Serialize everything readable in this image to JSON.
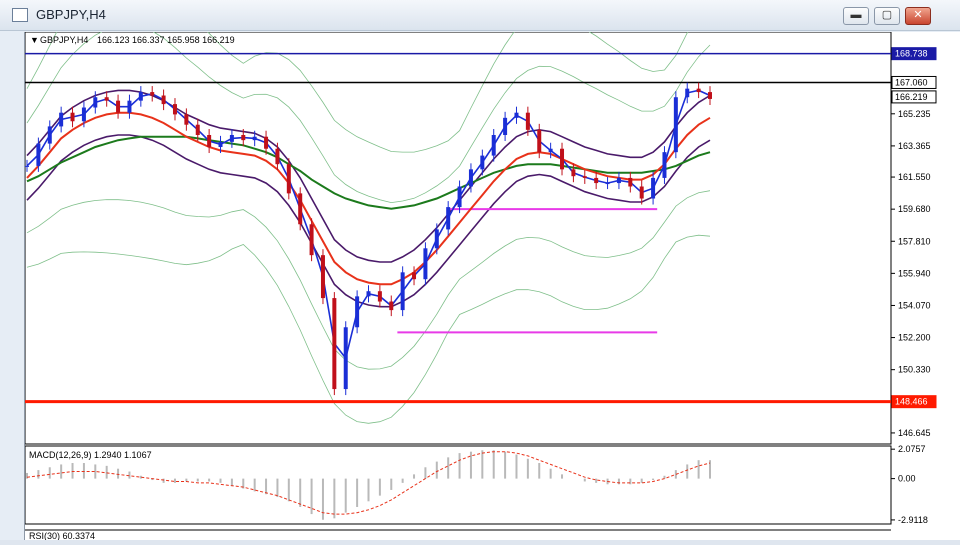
{
  "window": {
    "title": "GBPJPY,H4",
    "buttons": {
      "minimize": "▬",
      "maximize": "▢",
      "close": "✕"
    }
  },
  "chart_header": {
    "symbol": "GBPJPY,H4",
    "ohlc": "166.123 166.337 165.958 166.219"
  },
  "chart_data": {
    "type": "line",
    "title": "GBPJPY,H4 166.123 166.337 165.958 166.219",
    "ylim": [
      146.0,
      170.0
    ],
    "y_ticks": [
      "165.235",
      "163.365",
      "161.550",
      "159.680",
      "157.810",
      "155.940",
      "154.070",
      "152.200",
      "150.330",
      "146.645"
    ],
    "price_labels": {
      "resistance_blue": "168.738",
      "level_black": "167.060",
      "current": "166.219",
      "support_red": "148.466"
    },
    "horizontal_lines": [
      {
        "name": "resistance",
        "value": 168.738,
        "color": "#1a1aa6"
      },
      {
        "name": "level",
        "value": 167.06,
        "color": "#000000"
      },
      {
        "name": "support",
        "value": 148.466,
        "color": "#ff1a00"
      }
    ],
    "magenta_levels": [
      {
        "value": 159.68,
        "from": 0.49,
        "to": 0.73
      },
      {
        "value": 152.5,
        "from": 0.43,
        "to": 0.73
      }
    ],
    "price_series": [
      162.2,
      163.5,
      164.5,
      165.3,
      164.8,
      165.6,
      166.2,
      166.0,
      165.3,
      166.0,
      166.5,
      166.3,
      165.8,
      165.2,
      164.6,
      164.0,
      163.3,
      163.6,
      164.0,
      163.7,
      163.9,
      163.2,
      162.3,
      160.6,
      158.8,
      157.0,
      154.5,
      149.2,
      152.8,
      154.6,
      154.9,
      154.3,
      153.8,
      156.0,
      155.6,
      157.4,
      158.5,
      159.8,
      161.0,
      162.0,
      162.8,
      164.0,
      165.0,
      165.3,
      164.3,
      163.0,
      163.2,
      162.0,
      161.6,
      161.5,
      161.2,
      161.2,
      161.5,
      161.0,
      160.3,
      161.5,
      163.0,
      166.2,
      166.7,
      166.5,
      166.1
    ],
    "ma_red": [
      161.5,
      162.2,
      163.0,
      163.8,
      164.3,
      164.7,
      165.0,
      165.2,
      165.3,
      165.3,
      165.2,
      165.0,
      164.7,
      164.3,
      163.9,
      163.6,
      163.3,
      163.1,
      163.0,
      162.9,
      162.8,
      162.5,
      162.0,
      161.2,
      160.2,
      159.0,
      157.8,
      156.6,
      156.0,
      155.6,
      155.4,
      155.3,
      155.3,
      155.6,
      156.0,
      156.6,
      157.3,
      158.1,
      158.9,
      159.7,
      160.5,
      161.3,
      162.0,
      162.6,
      162.9,
      163.0,
      162.9,
      162.6,
      162.3,
      162.0,
      161.8,
      161.6,
      161.5,
      161.4,
      161.4,
      161.7,
      162.3,
      163.2,
      164.0,
      164.6,
      165.0
    ],
    "ma_green": [
      161.3,
      161.6,
      162.0,
      162.4,
      162.7,
      163.0,
      163.3,
      163.5,
      163.7,
      163.8,
      163.9,
      163.9,
      163.9,
      163.9,
      163.9,
      163.8,
      163.7,
      163.6,
      163.5,
      163.4,
      163.2,
      163.0,
      162.7,
      162.3,
      161.9,
      161.4,
      161.0,
      160.6,
      160.3,
      160.1,
      159.9,
      159.8,
      159.7,
      159.8,
      159.9,
      160.1,
      160.3,
      160.6,
      160.9,
      161.2,
      161.5,
      161.8,
      162.0,
      162.2,
      162.3,
      162.3,
      162.3,
      162.2,
      162.1,
      162.0,
      161.9,
      161.8,
      161.8,
      161.8,
      161.8,
      161.9,
      162.0,
      162.2,
      162.5,
      162.8,
      163.0
    ],
    "macd": {
      "label": "MACD(12,26,9) 1.2940 1.1067",
      "ylim": [
        -3.2,
        2.3
      ],
      "ticks": [
        "2.0757",
        "0.00",
        "-2.9118"
      ],
      "histogram": [
        0.4,
        0.6,
        0.8,
        1.0,
        1.1,
        1.1,
        1.0,
        0.9,
        0.7,
        0.5,
        0.2,
        -0.1,
        -0.3,
        -0.3,
        -0.2,
        -0.2,
        -0.2,
        -0.3,
        -0.5,
        -0.7,
        -0.9,
        -1.1,
        -1.3,
        -1.6,
        -2.0,
        -2.5,
        -2.9,
        -2.8,
        -2.4,
        -2.0,
        -1.6,
        -1.2,
        -0.8,
        -0.3,
        0.3,
        0.8,
        1.2,
        1.5,
        1.8,
        1.9,
        2.0,
        2.0,
        1.9,
        1.7,
        1.4,
        1.1,
        0.7,
        0.3,
        0.0,
        -0.2,
        -0.3,
        -0.4,
        -0.4,
        -0.4,
        -0.3,
        -0.1,
        0.2,
        0.6,
        1.0,
        1.3,
        1.3
      ],
      "signal": [
        0.1,
        0.2,
        0.3,
        0.4,
        0.5,
        0.5,
        0.5,
        0.4,
        0.3,
        0.2,
        0.1,
        0.0,
        -0.1,
        -0.2,
        -0.2,
        -0.3,
        -0.3,
        -0.4,
        -0.5,
        -0.6,
        -0.8,
        -1.0,
        -1.2,
        -1.5,
        -1.8,
        -2.1,
        -2.4,
        -2.5,
        -2.5,
        -2.4,
        -2.2,
        -1.9,
        -1.5,
        -1.0,
        -0.5,
        0.0,
        0.5,
        0.9,
        1.3,
        1.6,
        1.8,
        1.9,
        1.9,
        1.8,
        1.6,
        1.3,
        1.0,
        0.7,
        0.4,
        0.1,
        -0.1,
        -0.2,
        -0.3,
        -0.3,
        -0.3,
        -0.2,
        0.0,
        0.3,
        0.6,
        0.9,
        1.1
      ]
    },
    "rsi_label": "RSI(30) 60.3374"
  }
}
